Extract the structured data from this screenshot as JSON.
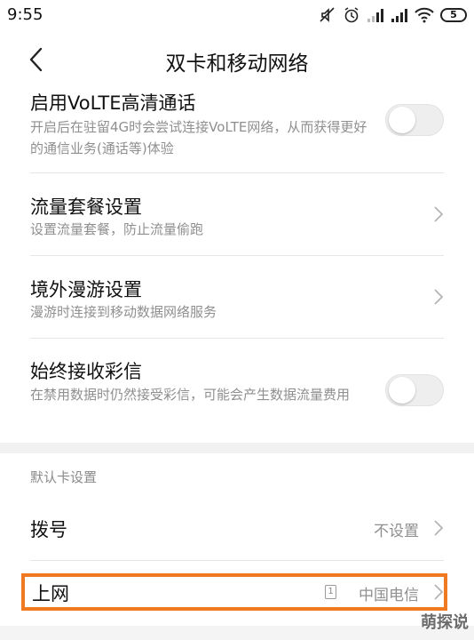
{
  "status_bar": {
    "time": "9:55",
    "battery_level": "5",
    "icons": [
      "mute-icon",
      "alarm-icon",
      "signal-icon",
      "signal-icon",
      "wifi-icon",
      "battery-icon"
    ]
  },
  "header": {
    "title": "双卡和移动网络"
  },
  "items": {
    "volte": {
      "title": "启用VoLTE高清通话",
      "desc": "开启后在驻留4G时会尝试连接VoLTE网络，从而获得更好的通信业务(通话等)体验",
      "toggle_on": false
    },
    "data_plan": {
      "title": "流量套餐设置",
      "desc": "设置流量套餐，防止流量偷跑"
    },
    "roaming": {
      "title": "境外漫游设置",
      "desc": "漫游时连接到移动数据网络服务"
    },
    "mms": {
      "title": "始终接收彩信",
      "desc": "在禁用数据时仍然接受彩信，可能会产生数据流量费用",
      "toggle_on": false
    }
  },
  "default_card": {
    "section_label": "默认卡设置",
    "dial": {
      "label": "拨号",
      "value": "不设置"
    },
    "internet": {
      "label": "上网",
      "sim_slot": "1",
      "value": "中国电信"
    }
  },
  "watermark": "萌探说",
  "colors": {
    "highlight": "#f07a22",
    "secondary_text": "#8f8f8f",
    "toggle_off": "#eeeeee"
  }
}
